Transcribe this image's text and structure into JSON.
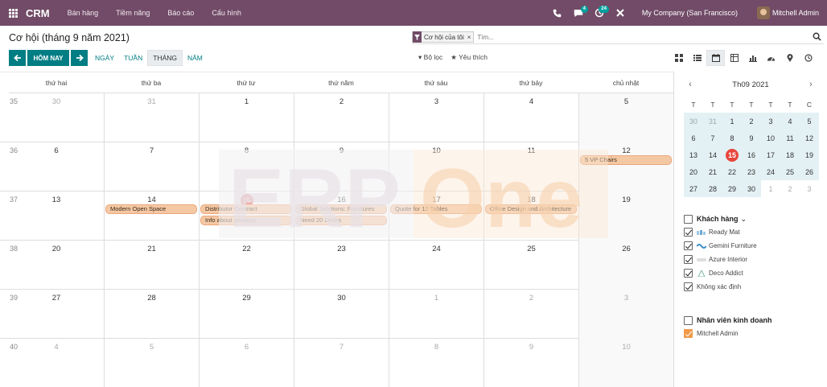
{
  "topnav": {
    "brand": "CRM",
    "menu": [
      "Bán hàng",
      "Tiềm năng",
      "Báo cáo",
      "Cấu hình"
    ],
    "messages_count": "4",
    "activities_count": "24",
    "company": "My Company (San Francisco)",
    "user": "Mitchell Admin"
  },
  "control": {
    "title": "Cơ hội (tháng 9 năm 2021)",
    "facet_label": "Cơ hội của tôi",
    "facet_remove": "×",
    "search_placeholder": "Tìm...",
    "today_label": "HÔM NAY",
    "scales": [
      "NGÀY",
      "TUẦN",
      "THÁNG",
      "NĂM"
    ],
    "active_scale": "THÁNG",
    "filter_label": "Bộ lọc",
    "favorites_label": "Yêu thích"
  },
  "calendar": {
    "weekdays": [
      "thứ hai",
      "thứ ba",
      "thứ tư",
      "thứ năm",
      "thứ sáu",
      "thứ bảy",
      "chủ nhật"
    ],
    "weeks": [
      {
        "num": "35",
        "days": [
          "30",
          "31",
          "1",
          "2",
          "3",
          "4",
          "5"
        ]
      },
      {
        "num": "36",
        "days": [
          "6",
          "7",
          "8",
          "9",
          "10",
          "11",
          "12"
        ]
      },
      {
        "num": "37",
        "days": [
          "13",
          "14",
          "15",
          "16",
          "17",
          "18",
          "19"
        ]
      },
      {
        "num": "38",
        "days": [
          "20",
          "21",
          "22",
          "23",
          "24",
          "25",
          "26"
        ]
      },
      {
        "num": "39",
        "days": [
          "27",
          "28",
          "29",
          "30",
          "1",
          "2",
          "3"
        ]
      },
      {
        "num": "40",
        "days": [
          "4",
          "5",
          "6",
          "7",
          "8",
          "9",
          "10"
        ]
      }
    ],
    "events": [
      {
        "title": "5 VP Chairs",
        "week": 1,
        "day": 6,
        "row": 0
      },
      {
        "title": "Modern Open Space",
        "week": 2,
        "day": 1,
        "row": 0
      },
      {
        "title": "Distributor Contract",
        "week": 2,
        "day": 2,
        "row": 0
      },
      {
        "title": "Info about services",
        "week": 2,
        "day": 2,
        "row": 1
      },
      {
        "title": "Global Solutions: Furnitures",
        "week": 2,
        "day": 3,
        "row": 0
      },
      {
        "title": "Need 20 Desks",
        "week": 2,
        "day": 3,
        "row": 1
      },
      {
        "title": "Quote for 12 Tables",
        "week": 2,
        "day": 4,
        "row": 0
      },
      {
        "title": "Office Design and Architecture",
        "week": 2,
        "day": 5,
        "row": 0
      }
    ]
  },
  "mini_calendar": {
    "month_label": "Th09 2021",
    "dow": [
      "T",
      "T",
      "T",
      "T",
      "T",
      "T",
      "C"
    ],
    "days": [
      "30",
      "31",
      "1",
      "2",
      "3",
      "4",
      "5",
      "6",
      "7",
      "8",
      "9",
      "10",
      "11",
      "12",
      "13",
      "14",
      "15",
      "16",
      "17",
      "18",
      "19",
      "20",
      "21",
      "22",
      "23",
      "24",
      "25",
      "26",
      "27",
      "28",
      "29",
      "30",
      "1",
      "2",
      "3"
    ]
  },
  "filters": {
    "customers_title": "Khách hàng",
    "customers": [
      "Ready Mat",
      "Gemini Furniture",
      "Azure Interior",
      "Deco Addict",
      "Không xác định"
    ],
    "salesperson_title": "Nhân viên kinh doanh",
    "salespersons": [
      "Mitchell Admin"
    ]
  },
  "colors": {
    "nav": "#714b67",
    "primary": "#017e84",
    "event_bg": "#f5c8a4",
    "today": "#e8453c"
  }
}
